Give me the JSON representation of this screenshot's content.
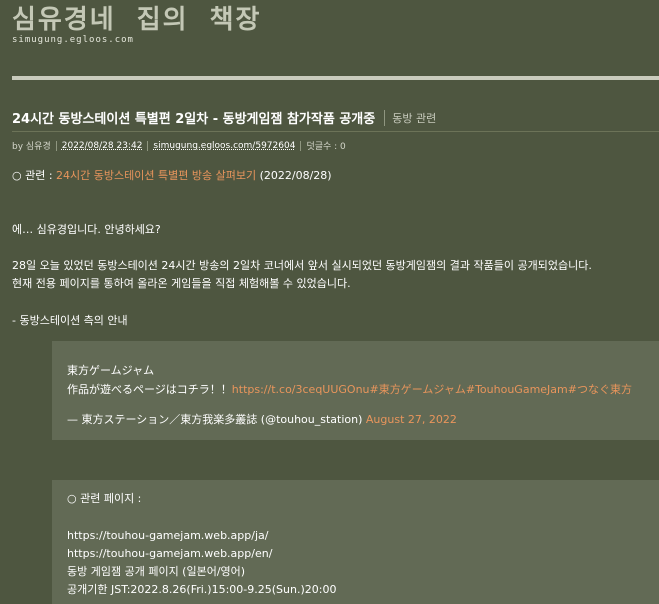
{
  "blog": {
    "title": "심유경네 집의 책장",
    "domain": "simugung.egloos.com"
  },
  "post": {
    "title": "24시간 동방스테이션 특별편 2일차 - 동방게임잼 참가작품 공개중",
    "category": "동방 관련",
    "meta": {
      "by": "by 심유경",
      "date": "2022/08/28 23:42",
      "permalink": "simugung.egloos.com/5972604",
      "comments": "덧글수 : 0"
    }
  },
  "related": {
    "prefix": "○ 관련 : ",
    "link_text": "24시간 동방스테이션 특별편 방송 살펴보기",
    "date": " (2022/08/28)"
  },
  "paragraphs": {
    "greeting": "에… 심유경입니다. 안녕하세요?",
    "p1_line1": "28일 오늘 있었던 동방스테이션 24시간 방송의 2일차 코너에서 앞서 실시되었던 동방게임잼의 결과 작품들이 공개되었습니다.",
    "p1_line2": "현재 전용 페이지를 통하여 올라온 게임들을 직접 체험해볼 수 있었습니다.",
    "notice": "- 동방스테이션 측의 안내"
  },
  "tweet": {
    "line1": "東方ゲームジャム",
    "line2_prefix": "作品が遊べるページはコチラ！！",
    "line2_links": "https://t.co/3ceqUUGOnu#東方ゲームジャム#TouhouGameJam#つなぐ東方",
    "author": "— 東方ステーション／東方我楽多叢誌 (@touhou_station) ",
    "date": "August 27, 2022"
  },
  "related_pages": {
    "heading": "○ 관련 페이지 :",
    "link_ja": "https://touhou-gamejam.web.app/ja/",
    "link_en": "https://touhou-gamejam.web.app/en/",
    "desc": "동방 게임잼 공개 페이지 (일본어/영어)",
    "period": "공개기한 JST:2022.8.26(Fri.)15:00-9.25(Sun.)20:00"
  }
}
